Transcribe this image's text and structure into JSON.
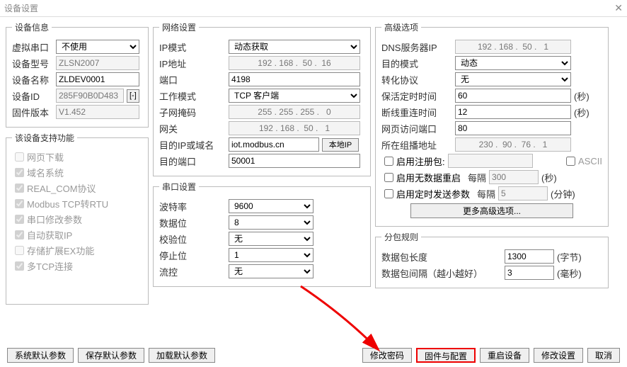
{
  "window": {
    "title": "设备设置",
    "close_glyph": "✕"
  },
  "device_info": {
    "legend": "设备信息",
    "virtual_com_label": "虚拟串口",
    "virtual_com_value": "不使用",
    "model_label": "设备型号",
    "model_value": "ZLSN2007",
    "name_label": "设备名称",
    "name_value": "ZLDEV0001",
    "id_label": "设备ID",
    "id_value": "285F90B0D483",
    "id_btn": "[-]",
    "fw_label": "固件版本",
    "fw_value": "V1.452"
  },
  "features": {
    "legend": "该设备支持功能",
    "items": [
      {
        "label": "网页下载",
        "checked": false
      },
      {
        "label": "域名系统",
        "checked": true
      },
      {
        "label": "REAL_COM协议",
        "checked": true
      },
      {
        "label": "Modbus TCP转RTU",
        "checked": true
      },
      {
        "label": "串口修改参数",
        "checked": true
      },
      {
        "label": "自动获取IP",
        "checked": true
      },
      {
        "label": "存储扩展EX功能",
        "checked": false
      },
      {
        "label": "多TCP连接",
        "checked": true
      }
    ]
  },
  "network": {
    "legend": "网络设置",
    "ip_mode_label": "IP模式",
    "ip_mode_value": "动态获取",
    "ip_addr_label": "IP地址",
    "ip_addr_value": "192 . 168 .  50 .  16",
    "port_label": "端口",
    "port_value": "4198",
    "work_mode_label": "工作模式",
    "work_mode_value": "TCP 客户端",
    "subnet_label": "子网掩码",
    "subnet_value": "255 . 255 . 255 .   0",
    "gateway_label": "网关",
    "gateway_value": "192 . 168 .  50 .   1",
    "dest_ip_label": "目的IP或域名",
    "dest_ip_value": "iot.modbus.cn",
    "local_ip_btn": "本地IP",
    "dest_port_label": "目的端口",
    "dest_port_value": "50001"
  },
  "serial": {
    "legend": "串口设置",
    "baud_label": "波特率",
    "baud_value": "9600",
    "databits_label": "数据位",
    "databits_value": "8",
    "parity_label": "校验位",
    "parity_value": "无",
    "stopbits_label": "停止位",
    "stopbits_value": "1",
    "flow_label": "流控",
    "flow_value": "无"
  },
  "advanced": {
    "legend": "高级选项",
    "dns_label": "DNS服务器IP",
    "dns_value": "192 . 168 .  50 .   1",
    "dest_mode_label": "目的模式",
    "dest_mode_value": "动态",
    "conv_proto_label": "转化协议",
    "conv_proto_value": "无",
    "keepalive_label": "保活定时时间",
    "keepalive_value": "60",
    "seconds_unit": "(秒)",
    "reconnect_label": "断线重连时间",
    "reconnect_value": "12",
    "web_port_label": "网页访问端口",
    "web_port_value": "80",
    "multicast_label": "所在组播地址",
    "multicast_value": "230 .  90 .  76 .   1",
    "enable_reg_label": "启用注册包:",
    "ascii_label": "ASCII",
    "enable_nodata_label": "启用无数据重启",
    "every_label": "每隔",
    "nodata_value": "300",
    "enable_sched_label": "启用定时发送参数",
    "sched_value": "5",
    "minutes_unit": "(分钟)",
    "more_btn": "更多高级选项..."
  },
  "packet": {
    "legend": "分包规则",
    "len_label": "数据包长度",
    "len_value": "1300",
    "bytes_unit": "(字节)",
    "gap_label": "数据包间隔（越小越好）",
    "gap_value": "3",
    "ms_unit": "(毫秒)"
  },
  "buttons": {
    "sys_default": "系统默认参数",
    "save_default": "保存默认参数",
    "load_default": "加载默认参数",
    "change_pwd": "修改密码",
    "firmware": "固件与配置",
    "reboot": "重启设备",
    "apply": "修改设置",
    "cancel": "取消"
  }
}
